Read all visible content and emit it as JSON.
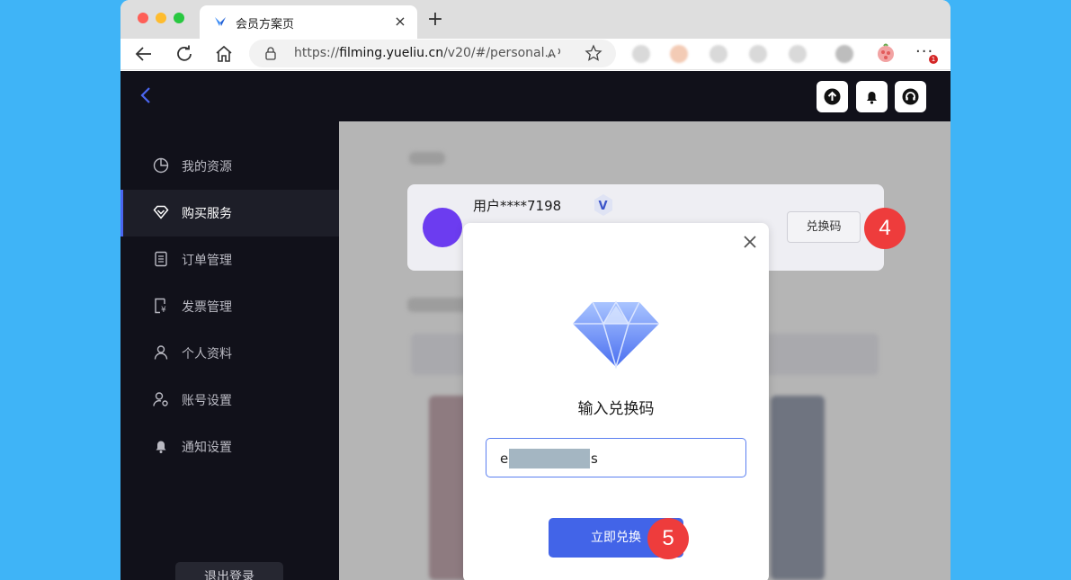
{
  "browser": {
    "tab_title": "会员方案页",
    "new_tab_glyph": "+",
    "tab_close_glyph": "×",
    "address": {
      "prefix": "https://",
      "host": "filming.yueliu.cn",
      "path": "/v20/#/personal..."
    },
    "more_badge": "1"
  },
  "sidebar": {
    "items": [
      {
        "label": "我的资源",
        "icon": "pie-chart-icon",
        "active": false
      },
      {
        "label": "购买服务",
        "icon": "diamond-icon",
        "active": true
      },
      {
        "label": "订单管理",
        "icon": "document-list-icon",
        "active": false
      },
      {
        "label": "发票管理",
        "icon": "invoice-icon",
        "active": false
      },
      {
        "label": "个人资料",
        "icon": "user-icon",
        "active": false
      },
      {
        "label": "账号设置",
        "icon": "user-settings-icon",
        "active": false
      },
      {
        "label": "通知设置",
        "icon": "bell-icon",
        "active": false
      }
    ],
    "logout_label": "退出登录"
  },
  "header": {
    "icons": [
      "upload-icon",
      "bell-icon",
      "headset-icon"
    ]
  },
  "user_card": {
    "username": "用户****7198",
    "badge_letter": "V",
    "redeem_button": "兑换码"
  },
  "steps": {
    "redeem": "4",
    "confirm": "5"
  },
  "modal": {
    "title": "输入兑换码",
    "code_visible_start": "e",
    "code_visible_end": "s",
    "confirm_button": "立即兑换"
  },
  "colors": {
    "accent": "#4264e8",
    "step_badge": "#ee3c3c",
    "avatar": "#6c3cf0",
    "app_bg": "#11111a"
  }
}
